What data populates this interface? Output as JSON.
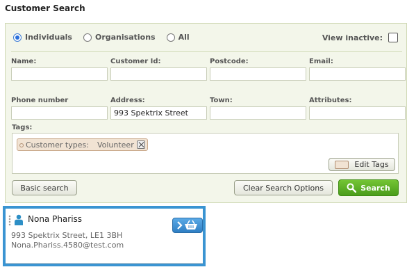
{
  "page": {
    "title": "Customer Search"
  },
  "search_type": {
    "options": [
      {
        "label": "Individuals",
        "selected": true
      },
      {
        "label": "Organisations",
        "selected": false
      },
      {
        "label": "All",
        "selected": false
      }
    ],
    "view_inactive_label": "View inactive:",
    "view_inactive_checked": false
  },
  "fields": {
    "name": {
      "label": "Name:",
      "value": ""
    },
    "customer_id": {
      "label": "Customer Id:",
      "value": ""
    },
    "postcode": {
      "label": "Postcode:",
      "value": ""
    },
    "email": {
      "label": "Email:",
      "value": ""
    },
    "phone": {
      "label": "Phone number",
      "value": ""
    },
    "address": {
      "label": "Address:",
      "value": "993 Spektrix Street"
    },
    "town": {
      "label": "Town:",
      "value": ""
    },
    "attributes": {
      "label": "Attributes:",
      "value": ""
    }
  },
  "tags": {
    "label": "Tags:",
    "items": [
      {
        "key": "Customer types:",
        "value": "Volunteer"
      }
    ],
    "edit_label": "Edit Tags"
  },
  "buttons": {
    "basic": "Basic search",
    "clear": "Clear Search Options",
    "search": "Search"
  },
  "result": {
    "name": "Nona Phariss",
    "address": "993 Spektrix Street, LE1 3BH",
    "email": "Nona.Phariss.4580@test.com"
  },
  "colors": {
    "accent_green": "#5ab026",
    "selection_blue": "#3a94d2",
    "panel_bg": "#f3f6ea"
  }
}
